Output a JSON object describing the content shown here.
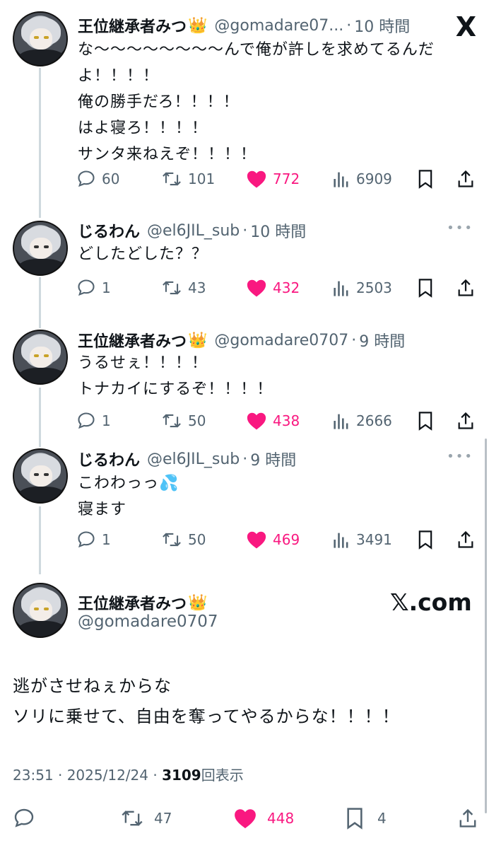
{
  "app": {
    "logo": "X"
  },
  "tweets": [
    {
      "name": "王位継承者みつ",
      "crown": "👑",
      "handle": "@gomadare07...",
      "sep": "·",
      "time": "10 時間",
      "body": "な〜〜〜〜〜〜〜〜んで俺が許しを求めてるんだ\nよ！！！！\n俺の勝手だろ！！！！\nはよ寝ろ！！！！\nサンタ来ねえぞ！！！！",
      "replies": "60",
      "retweets": "101",
      "likes": "772",
      "views": "6909"
    },
    {
      "name": "じるわん",
      "crown": "",
      "handle": "@el6JIL_sub",
      "sep": "·",
      "time": "10 時間",
      "body": "どしたどした？？",
      "replies": "1",
      "retweets": "43",
      "likes": "432",
      "views": "2503"
    },
    {
      "name": "王位継承者みつ",
      "crown": "👑",
      "handle": "@gomadare0707",
      "sep": "·",
      "time": "9 時間",
      "body": "うるせぇ！！！！\nトナカイにするぞ！！！！",
      "replies": "1",
      "retweets": "50",
      "likes": "438",
      "views": "2666"
    },
    {
      "name": "じるわん",
      "crown": "",
      "handle": "@el6JIL_sub",
      "sep": "·",
      "time": "9 時間",
      "body": "こわわっっ💦\n寝ます",
      "replies": "1",
      "retweets": "50",
      "likes": "469",
      "views": "3491"
    }
  ],
  "main": {
    "name": "王位継承者みつ",
    "crown": "👑",
    "handle": "@gomadare0707",
    "watermark": "𝕏.com",
    "body": "逃がさせねぇからな\nソリに乗せて、自由を奪ってやるからな！！！！",
    "time": "23:51 · 2025/12/24 · ",
    "views": "3109",
    "views_label": "回表示",
    "retweets": "47",
    "likes": "448",
    "bookmarks": "4"
  },
  "colors": {
    "like": "#f91880",
    "muted": "#536471",
    "thread": "#cfd9de"
  },
  "icons": [
    "reply-icon",
    "retweet-icon",
    "heart-icon",
    "views-icon",
    "bookmark-icon",
    "share-icon",
    "more-icon",
    "x-logo-icon"
  ]
}
